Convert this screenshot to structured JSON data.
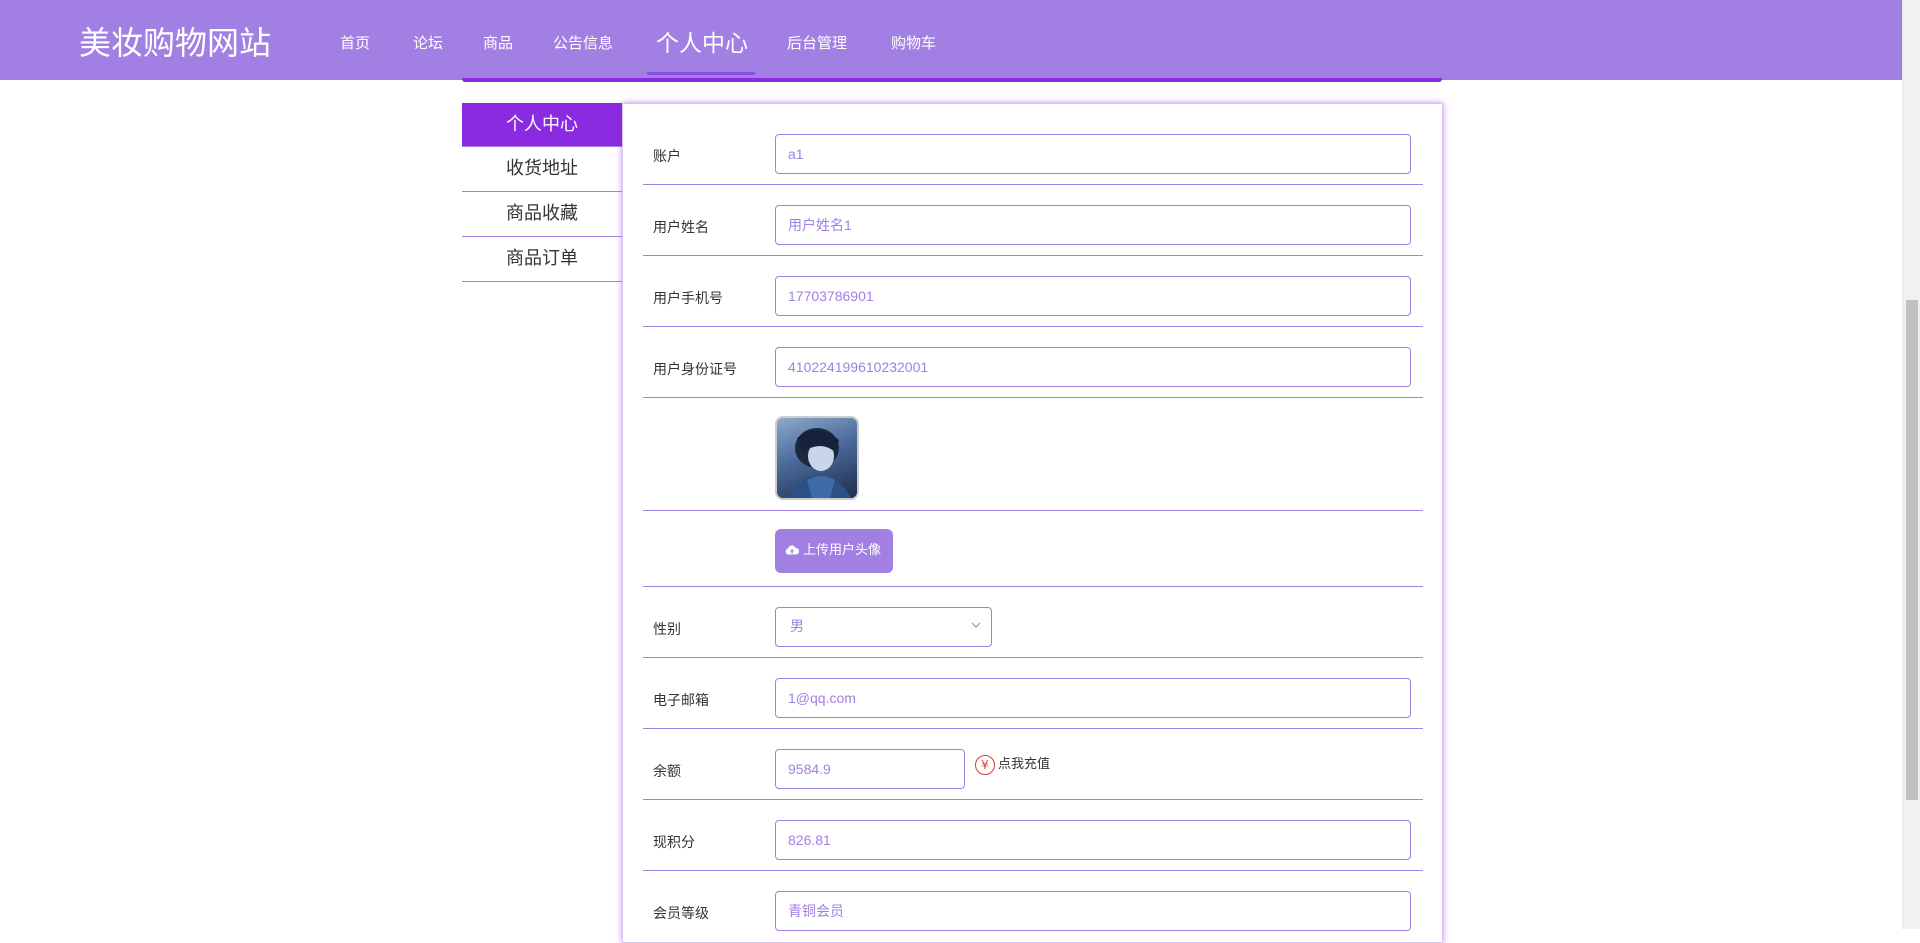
{
  "header": {
    "logo": "美妆购物网站",
    "nav": [
      {
        "label": "首页"
      },
      {
        "label": "论坛"
      },
      {
        "label": "商品"
      },
      {
        "label": "公告信息"
      },
      {
        "label": "个人中心",
        "active": true
      },
      {
        "label": "后台管理"
      },
      {
        "label": "购物车"
      }
    ]
  },
  "sidebar": {
    "items": [
      {
        "label": "个人中心",
        "active": true
      },
      {
        "label": "收货地址"
      },
      {
        "label": "商品收藏"
      },
      {
        "label": "商品订单"
      }
    ]
  },
  "form": {
    "account": {
      "label": "账户",
      "value": "a1"
    },
    "username": {
      "label": "用户姓名",
      "value": "用户姓名1"
    },
    "phone": {
      "label": "用户手机号",
      "value": "17703786901"
    },
    "id_card": {
      "label": "用户身份证号",
      "value": "410224199610232001"
    },
    "upload_label": "上传用户头像",
    "gender": {
      "label": "性别",
      "value": "男"
    },
    "email": {
      "label": "电子邮箱",
      "value": "1@qq.com"
    },
    "balance": {
      "label": "余额",
      "value": "9584.9",
      "recharge": "点我充值",
      "recharge_icon": "¥"
    },
    "points": {
      "label": "现积分",
      "value": "826.81"
    },
    "member_level": {
      "label": "会员等级",
      "value": "青铜会员"
    }
  },
  "colors": {
    "header_bg": "#a280e3",
    "accent": "#8a2be2",
    "input_border": "#a280e3",
    "text_value": "#a280e3"
  }
}
